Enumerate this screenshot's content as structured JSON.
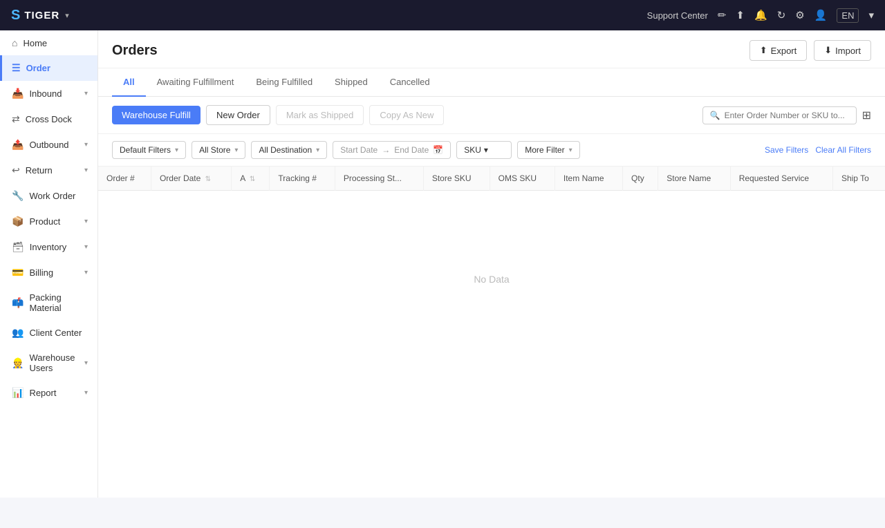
{
  "app": {
    "name": "TIGER",
    "lang": "EN"
  },
  "topnav": {
    "support_center": "Support Center",
    "lang_label": "EN"
  },
  "sidebar": {
    "items": [
      {
        "id": "home",
        "label": "Home",
        "icon": "🏠",
        "has_children": false,
        "active": false
      },
      {
        "id": "order",
        "label": "Order",
        "icon": "📋",
        "has_children": false,
        "active": true
      },
      {
        "id": "inbound",
        "label": "Inbound",
        "icon": "📦",
        "has_children": true,
        "active": false
      },
      {
        "id": "cross-dock",
        "label": "Cross Dock",
        "icon": "🔀",
        "has_children": false,
        "active": false
      },
      {
        "id": "outbound",
        "label": "Outbound",
        "icon": "🚚",
        "has_children": true,
        "active": false
      },
      {
        "id": "return",
        "label": "Return",
        "icon": "↩",
        "has_children": true,
        "active": false
      },
      {
        "id": "work-order",
        "label": "Work Order",
        "icon": "🔧",
        "has_children": false,
        "active": false
      },
      {
        "id": "product",
        "label": "Product",
        "icon": "📦",
        "has_children": true,
        "active": false
      },
      {
        "id": "inventory",
        "label": "Inventory",
        "icon": "🗃",
        "has_children": true,
        "active": false
      },
      {
        "id": "billing",
        "label": "Billing",
        "icon": "💳",
        "has_children": true,
        "active": false
      },
      {
        "id": "packing-material",
        "label": "Packing Material",
        "icon": "📫",
        "has_children": false,
        "active": false
      },
      {
        "id": "client-center",
        "label": "Client Center",
        "icon": "👥",
        "has_children": false,
        "active": false
      },
      {
        "id": "warehouse-users",
        "label": "Warehouse Users",
        "icon": "👷",
        "has_children": true,
        "active": false
      },
      {
        "id": "report",
        "label": "Report",
        "icon": "📊",
        "has_children": true,
        "active": false
      }
    ]
  },
  "page": {
    "title": "Orders",
    "export_label": "Export",
    "import_label": "Import"
  },
  "tabs": [
    {
      "id": "all",
      "label": "All",
      "active": true
    },
    {
      "id": "awaiting",
      "label": "Awaiting Fulfillment",
      "active": false
    },
    {
      "id": "being-fulfilled",
      "label": "Being Fulfilled",
      "active": false
    },
    {
      "id": "shipped",
      "label": "Shipped",
      "active": false
    },
    {
      "id": "cancelled",
      "label": "Cancelled",
      "active": false
    }
  ],
  "toolbar": {
    "warehouse_fulfill_label": "Warehouse Fulfill",
    "new_order_label": "New Order",
    "mark_as_shipped_label": "Mark as Shipped",
    "copy_as_new_label": "Copy As New",
    "search_placeholder": "Enter Order Number or SKU to..."
  },
  "filters": {
    "default_filters_label": "Default Filters",
    "all_store_label": "All Store",
    "all_destination_label": "All Destination",
    "start_date_label": "Start Date",
    "end_date_label": "End Date",
    "sku_label": "SKU",
    "more_filter_label": "More Filter",
    "save_filters_label": "Save Filters",
    "clear_all_filters_label": "Clear All Filters"
  },
  "table": {
    "columns": [
      {
        "id": "order-num",
        "label": "Order #",
        "sortable": false
      },
      {
        "id": "order-date",
        "label": "Order Date",
        "sortable": true
      },
      {
        "id": "a",
        "label": "A",
        "sortable": true
      },
      {
        "id": "tracking",
        "label": "Tracking #",
        "sortable": false
      },
      {
        "id": "processing-st",
        "label": "Processing St...",
        "sortable": false
      },
      {
        "id": "store-sku",
        "label": "Store SKU",
        "sortable": false
      },
      {
        "id": "oms-sku",
        "label": "OMS SKU",
        "sortable": false
      },
      {
        "id": "item-name",
        "label": "Item Name",
        "sortable": false
      },
      {
        "id": "qty",
        "label": "Qty",
        "sortable": false
      },
      {
        "id": "store-name",
        "label": "Store Name",
        "sortable": false
      },
      {
        "id": "requested-service",
        "label": "Requested Service",
        "sortable": false
      },
      {
        "id": "ship-to",
        "label": "Ship To",
        "sortable": false
      }
    ],
    "no_data_label": "No Data"
  }
}
